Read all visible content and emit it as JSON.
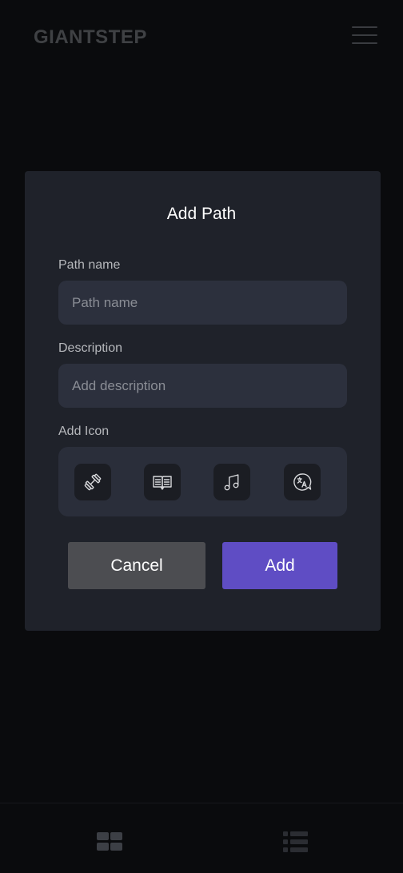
{
  "header": {
    "logo": "GIANTSTEP"
  },
  "modal": {
    "title": "Add Path",
    "path_name_label": "Path name",
    "path_name_placeholder": "Path name",
    "path_name_value": "",
    "description_label": "Description",
    "description_placeholder": "Add description",
    "description_value": "",
    "add_icon_label": "Add Icon",
    "icons": [
      "dumbbell-icon",
      "book-open-icon",
      "music-note-icon",
      "translate-icon"
    ],
    "cancel_label": "Cancel",
    "add_label": "Add"
  },
  "bottom_nav": {
    "items": [
      "grid-view-icon",
      "list-view-icon"
    ]
  },
  "colors": {
    "background": "#0a0b0d",
    "modal_bg": "#1f222a",
    "input_bg": "#2c303d",
    "accent": "#5f4dc4",
    "cancel_bg": "#4c4d51"
  }
}
